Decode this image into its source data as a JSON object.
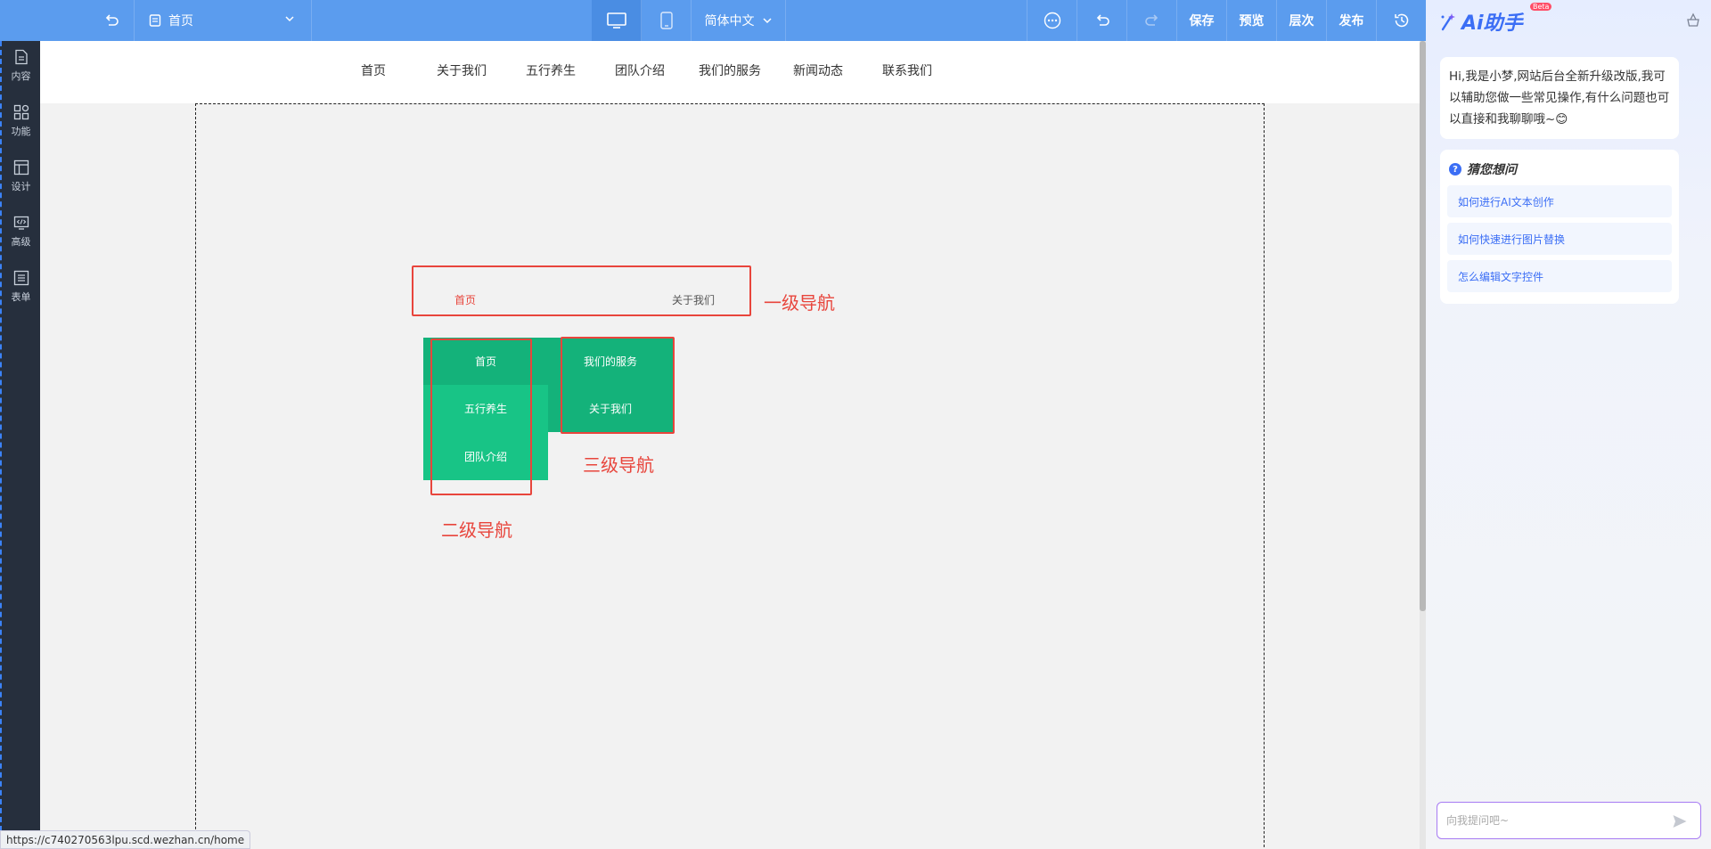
{
  "toolbar": {
    "page_selector": "首页",
    "language": "简体中文",
    "save": "保存",
    "preview": "预览",
    "layers": "层次",
    "publish": "发布"
  },
  "sidebar": {
    "items": [
      {
        "label": "内容",
        "icon": "document-icon"
      },
      {
        "label": "功能",
        "icon": "grid-icon"
      },
      {
        "label": "设计",
        "icon": "layout-icon"
      },
      {
        "label": "高级",
        "icon": "code-icon"
      },
      {
        "label": "表单",
        "icon": "form-icon"
      }
    ]
  },
  "site_nav": {
    "items": [
      "首页",
      "关于我们",
      "五行养生",
      "团队介绍",
      "我们的服务",
      "新闻动态",
      "联系我们"
    ]
  },
  "demo": {
    "level1": {
      "active": "首页",
      "other": "关于我们",
      "label": "一级导航"
    },
    "level2": {
      "items": [
        "首页",
        "五行养生",
        "团队介绍"
      ],
      "label": "二级导航"
    },
    "level3": {
      "items": [
        "我们的服务",
        "关于我们"
      ],
      "label": "三级导航"
    },
    "colors": {
      "green_dark": "#14b27a",
      "green_light": "#18c486",
      "red": "#e8453c"
    }
  },
  "status_url": "https://c740270563lpu.scd.wezhan.cn/home",
  "ai": {
    "title": "Ai助手",
    "beta": "Beta",
    "greeting": "Hi,我是小梦,网站后台全新升级改版,我可以辅助您做一些常见操作,有什么问题也可以直接和我聊聊哦~😊",
    "suggest_title": "猜您想问",
    "suggestions": [
      "如何进行AI文本创作",
      "如何快速进行图片替换",
      "怎么编辑文字控件"
    ],
    "input_placeholder": "向我提问吧~"
  },
  "theme": {
    "toolbar": "#5b9cee",
    "sidebar": "#262f3d",
    "accent": "#3b6ef5"
  }
}
